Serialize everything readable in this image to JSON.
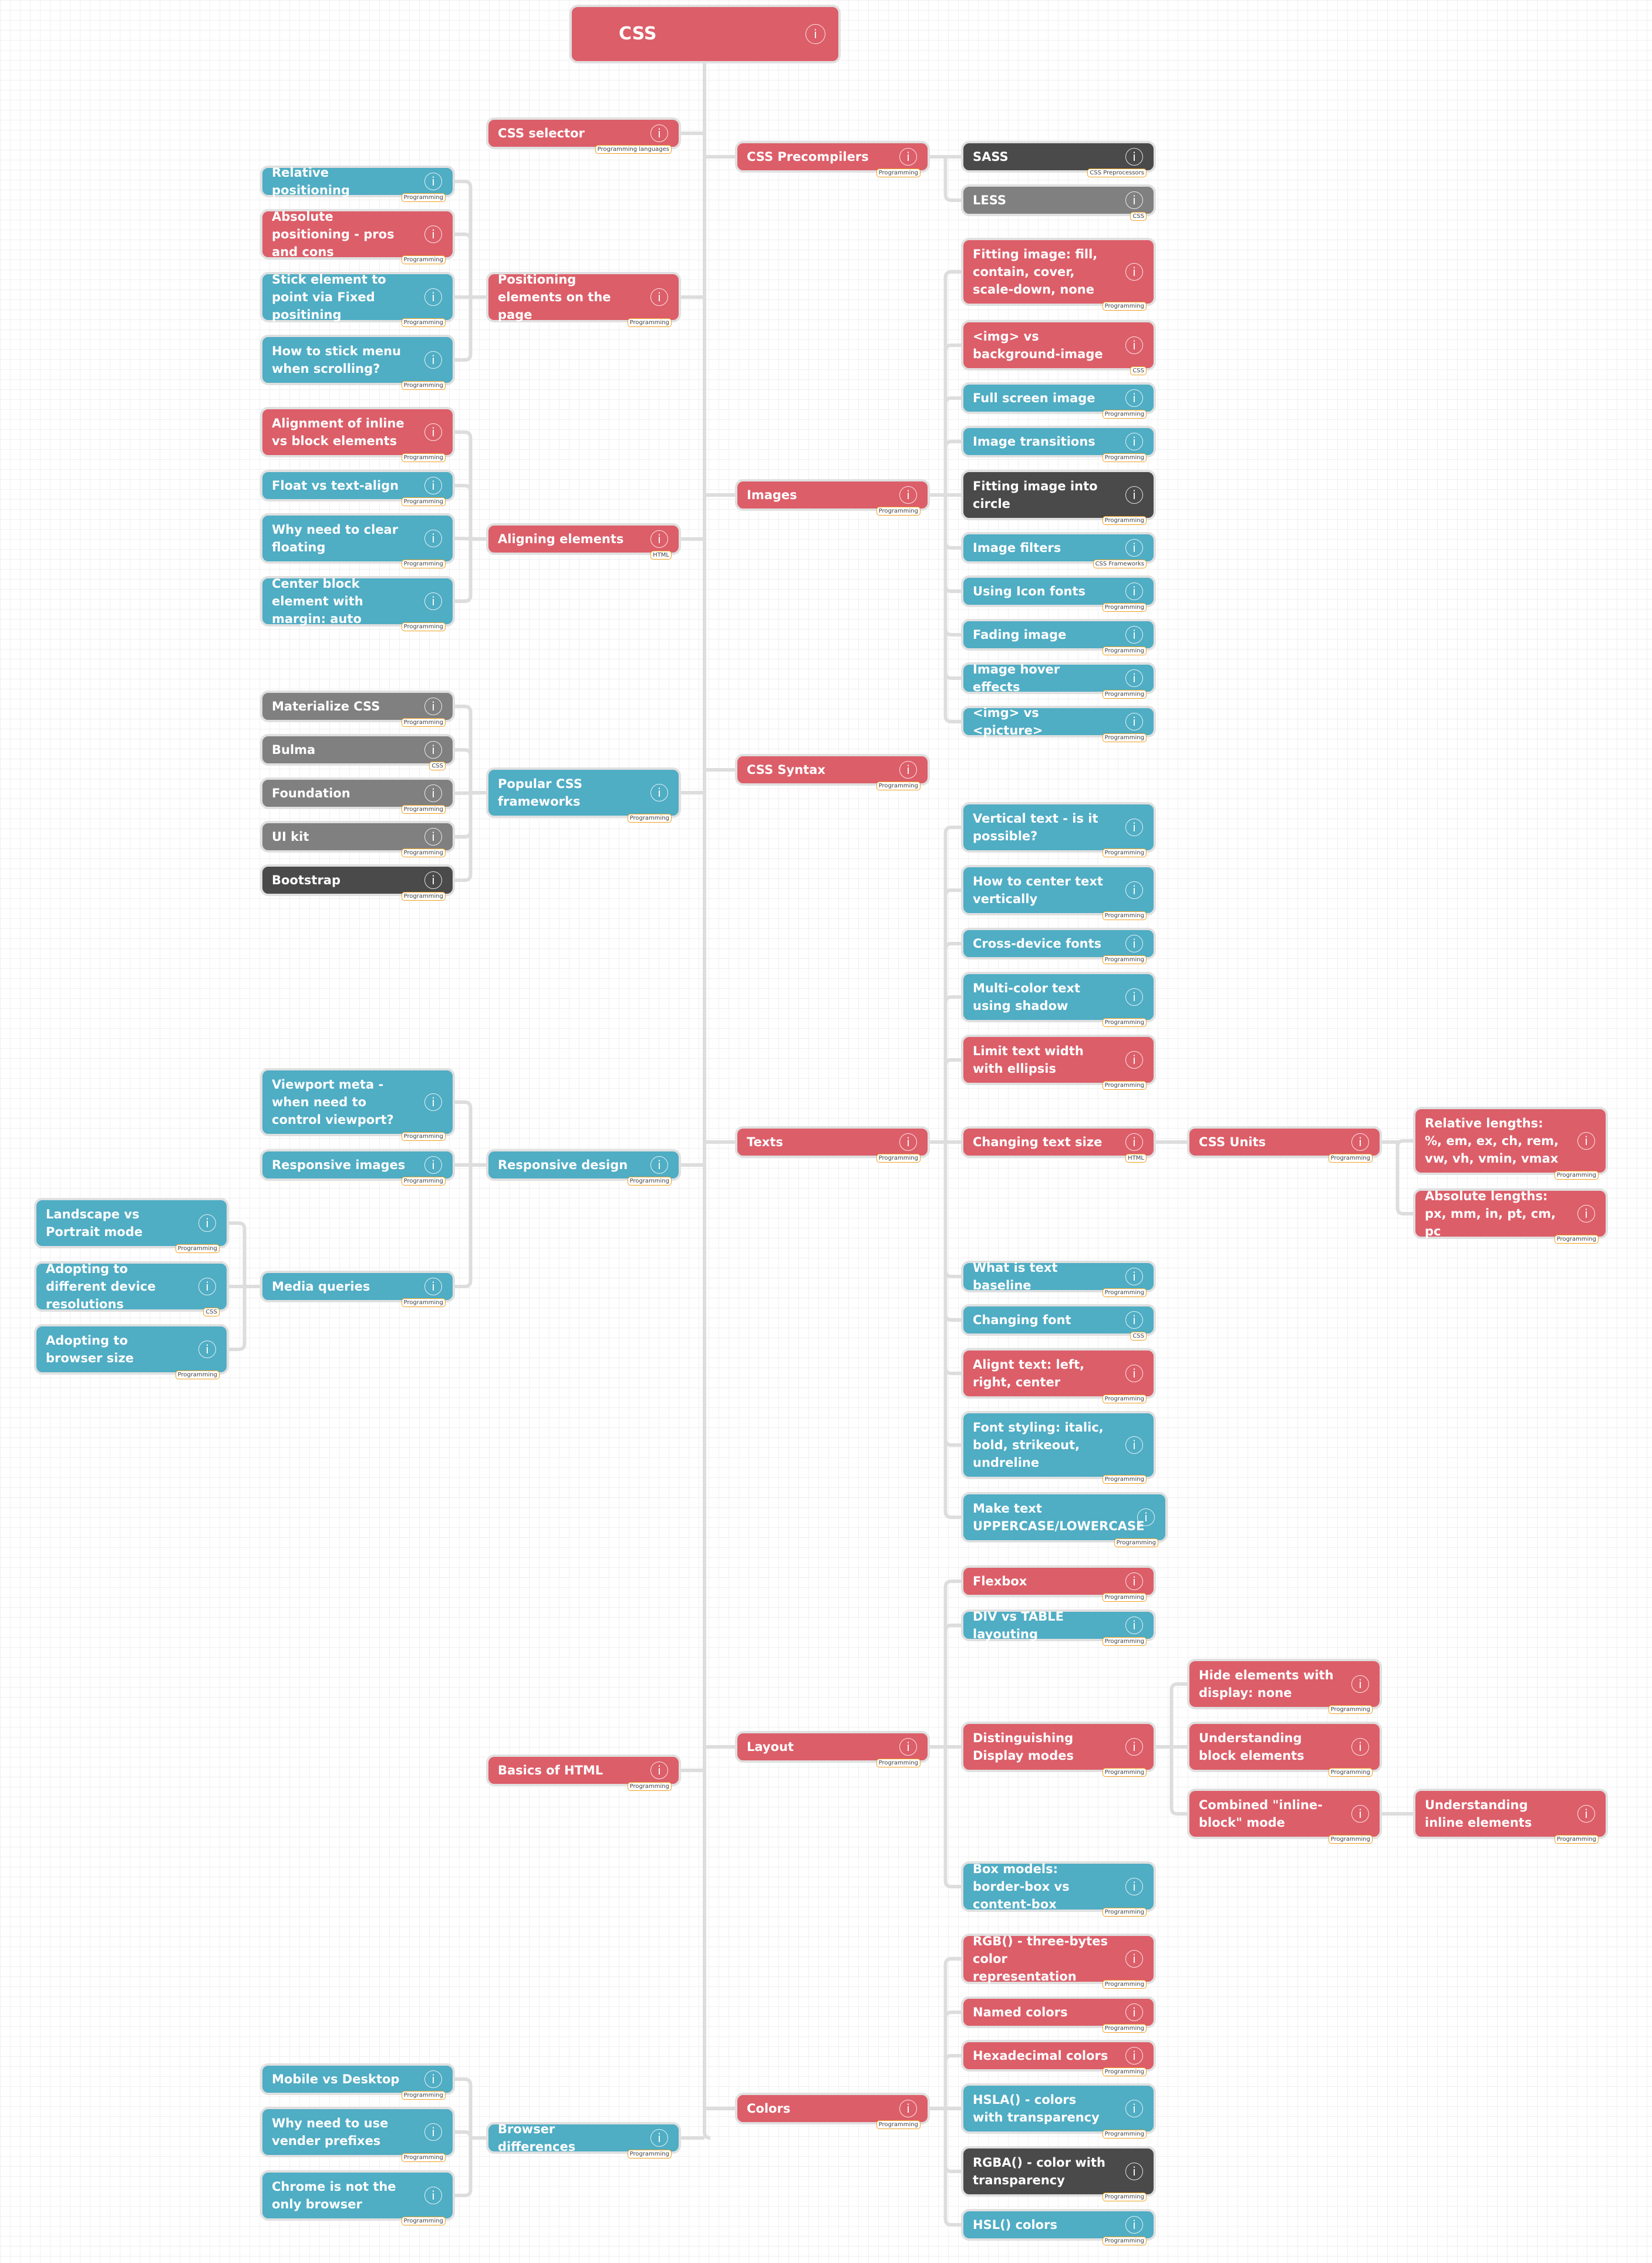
{
  "colors": {
    "red": "#dc5e69",
    "blue": "#4fadc4",
    "dark": "#4a4a4a",
    "grey": "#808080",
    "connector": "#dddddd",
    "tag_border": "#f0a020"
  },
  "root": {
    "label": "CSS"
  },
  "nodes": {
    "css_selector": {
      "label": "CSS selector",
      "tag": "Programming languages"
    },
    "positioning": {
      "label": "Positioning elements on the page",
      "tag": "Programming"
    },
    "relative_positioning": {
      "label": "Relative positioning",
      "tag": "Programming"
    },
    "absolute_positioning": {
      "label": "Absolute positioning - pros and cons",
      "tag": "Programming"
    },
    "fixed_positioning": {
      "label": "Stick element to point via Fixed positining",
      "tag": "Programming"
    },
    "stick_menu": {
      "label": "How to stick menu when scrolling?",
      "tag": "Programming"
    },
    "aligning": {
      "label": "Aligning elements",
      "tag": "HTML"
    },
    "inline_vs_block": {
      "label": "Alignment of inline vs block elements",
      "tag": "Programming"
    },
    "float_vs_textalign": {
      "label": "Float vs text-align",
      "tag": "Programming"
    },
    "clear_floating": {
      "label": "Why need to clear floating",
      "tag": "Programming"
    },
    "center_block": {
      "label": "Center block element with margin: auto",
      "tag": "Programming"
    },
    "frameworks": {
      "label": "Popular CSS frameworks",
      "tag": "Programming"
    },
    "materialize": {
      "label": "Materialize CSS",
      "tag": "Programming"
    },
    "bulma": {
      "label": "Bulma",
      "tag": "CSS"
    },
    "foundation": {
      "label": "Foundation",
      "tag": "Programming"
    },
    "ui_kit": {
      "label": "UI kit",
      "tag": "Programming"
    },
    "bootstrap": {
      "label": "Bootstrap",
      "tag": "Programming"
    },
    "responsive": {
      "label": "Responsive design",
      "tag": "Programming"
    },
    "viewport_meta": {
      "label": "Viewport meta - when need to control viewport?",
      "tag": "Programming"
    },
    "responsive_images": {
      "label": "Responsive images",
      "tag": "Programming"
    },
    "media_queries": {
      "label": "Media queries",
      "tag": "Programming"
    },
    "landscape_portrait": {
      "label": "Landscape vs Portrait mode",
      "tag": "Programming"
    },
    "device_resolutions": {
      "label": "Adopting to different device resolutions",
      "tag": "CSS"
    },
    "browser_size": {
      "label": "Adopting to browser size",
      "tag": "Programming"
    },
    "basics_html": {
      "label": "Basics of HTML",
      "tag": "Programming"
    },
    "browser_diff": {
      "label": "Browser differences",
      "tag": "Programming"
    },
    "mobile_desktop": {
      "label": "Mobile vs Desktop",
      "tag": "Programming"
    },
    "vendor_prefixes": {
      "label": "Why need to use vender prefixes",
      "tag": "Programming"
    },
    "chrome_not_only": {
      "label": "Chrome is not the only browser",
      "tag": "Programming"
    },
    "precompilers": {
      "label": "CSS Precompilers",
      "tag": "Programming"
    },
    "sass": {
      "label": "SASS",
      "tag": "CSS Preprocessors"
    },
    "less": {
      "label": "LESS",
      "tag": "CSS"
    },
    "images": {
      "label": "Images",
      "tag": "Programming"
    },
    "fitting_image": {
      "label": "Fitting image: fill, contain, cover, scale-down, none",
      "tag": "Programming"
    },
    "img_vs_bg": {
      "label": "<img> vs background-image",
      "tag": "CSS"
    },
    "full_screen_image": {
      "label": "Full screen image",
      "tag": "Programming"
    },
    "image_transitions": {
      "label": "Image transitions",
      "tag": "Programming"
    },
    "image_circle": {
      "label": "Fitting image into circle",
      "tag": "Programming"
    },
    "image_filters": {
      "label": "Image filters",
      "tag": "CSS Frameworks"
    },
    "icon_fonts": {
      "label": "Using Icon fonts",
      "tag": "Programming"
    },
    "fading_image": {
      "label": "Fading image",
      "tag": "Programming"
    },
    "image_hover": {
      "label": "Image hover effects",
      "tag": "Programming"
    },
    "img_vs_picture": {
      "label": "<img> vs <picture>",
      "tag": "Programming"
    },
    "css_syntax": {
      "label": "CSS Syntax",
      "tag": "Programming"
    },
    "texts": {
      "label": "Texts",
      "tag": "Programming"
    },
    "vertical_text": {
      "label": "Vertical text - is it possible?",
      "tag": "Programming"
    },
    "center_text": {
      "label": "How to center text vertically",
      "tag": "Programming"
    },
    "cross_device_fonts": {
      "label": "Cross-device fonts",
      "tag": "Programming"
    },
    "multicolor_text": {
      "label": "Multi-color text using shadow",
      "tag": "Programming"
    },
    "ellipsis": {
      "label": "Limit text width with ellipsis",
      "tag": "Programming"
    },
    "text_size": {
      "label": "Changing text size",
      "tag": "HTML"
    },
    "css_units": {
      "label": "CSS Units",
      "tag": "Programming"
    },
    "relative_lengths": {
      "label": "Relative lengths: %, em, ex, ch, rem, vw, vh, vmin, vmax",
      "tag": "Programming"
    },
    "absolute_lengths": {
      "label": "Absolute lengths: px, mm, in, pt, cm, pc",
      "tag": "Programming"
    },
    "text_baseline": {
      "label": "What is text baseline",
      "tag": "Programming"
    },
    "changing_font": {
      "label": "Changing font",
      "tag": "CSS"
    },
    "align_text": {
      "label": "Alignt text: left, right, center",
      "tag": "Programming"
    },
    "font_styling": {
      "label": "Font styling: italic, bold, strikeout, undreline",
      "tag": "Programming"
    },
    "text_case": {
      "label": "Make text UPPERCASE/LOWERCASE",
      "tag": "Programming"
    },
    "layout": {
      "label": "Layout",
      "tag": "Programming"
    },
    "flexbox": {
      "label": "Flexbox",
      "tag": "Programming"
    },
    "div_vs_table": {
      "label": "DIV vs TABLE layouting",
      "tag": "Programming"
    },
    "display_modes": {
      "label": "Distinguishing Display modes",
      "tag": "Programming"
    },
    "display_none": {
      "label": "Hide elements with display: none",
      "tag": "Programming"
    },
    "block_elements": {
      "label": "Understanding block elements",
      "tag": "Programming"
    },
    "inline_block": {
      "label": "Combined \"inline-block\" mode",
      "tag": "Programming"
    },
    "inline_elements": {
      "label": "Understanding inline elements",
      "tag": "Programming"
    },
    "box_models": {
      "label": "Box models: border-box vs content-box",
      "tag": "Programming"
    },
    "colors": {
      "label": "Colors",
      "tag": "Programming"
    },
    "rgb": {
      "label": "RGB() - three-bytes color representation",
      "tag": "Programming"
    },
    "named_colors": {
      "label": "Named colors",
      "tag": "Programming"
    },
    "hex_colors": {
      "label": "Hexadecimal colors",
      "tag": "Programming"
    },
    "hsla": {
      "label": "HSLA() - colors with transparency",
      "tag": "Programming"
    },
    "rgba": {
      "label": "RGBA() - color with transparency",
      "tag": "Programming"
    },
    "hsl": {
      "label": "HSL() colors",
      "tag": "Programming"
    }
  },
  "info_icon_glyph": "i"
}
